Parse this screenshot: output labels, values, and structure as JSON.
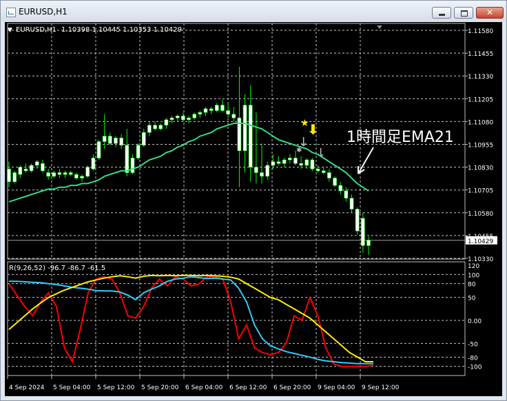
{
  "window": {
    "title": "EURUSD,H1",
    "close_glyph": "✕"
  },
  "chart_data": [
    {
      "type": "candlestick",
      "symbol_label": "EURUSD,H1",
      "ohlc_label": "1.10398 1.10445 1.10353 1.10429",
      "current_price": "1.10429",
      "annotation": "1時間足EMA21",
      "ylim": [
        1.1033,
        1.1158
      ],
      "price_ticks": [
        "1.11580",
        "1.11455",
        "1.11330",
        "1.11205",
        "1.11080",
        "1.10955",
        "1.10830",
        "1.10705",
        "1.10580",
        "1.10455",
        "1.10330"
      ],
      "grid": true,
      "colors": {
        "candle_bull": "#ffffff",
        "candle_bear": "#ffffff",
        "wick": "#00ff00",
        "ema": "#33dd88"
      },
      "candles": [
        [
          1.1082,
          1.1086,
          1.1072,
          1.1075
        ],
        [
          1.1075,
          1.1081,
          1.1074,
          1.108
        ],
        [
          1.1079,
          1.1084,
          1.1077,
          1.1083
        ],
        [
          1.1082,
          1.1085,
          1.108,
          1.1081
        ],
        [
          1.1081,
          1.1085,
          1.108,
          1.1084
        ],
        [
          1.1084,
          1.1087,
          1.1082,
          1.1086
        ],
        [
          1.1085,
          1.1087,
          1.108,
          1.1081
        ],
        [
          1.108,
          1.1082,
          1.1076,
          1.1078
        ],
        [
          1.1078,
          1.1081,
          1.1077,
          1.108
        ],
        [
          1.108,
          1.1082,
          1.1077,
          1.1079
        ],
        [
          1.1079,
          1.1081,
          1.1077,
          1.108
        ],
        [
          1.108,
          1.1081,
          1.1078,
          1.1079
        ],
        [
          1.1079,
          1.108,
          1.1076,
          1.1077
        ],
        [
          1.1077,
          1.1079,
          1.1075,
          1.1078
        ],
        [
          1.1078,
          1.1084,
          1.1077,
          1.1083
        ],
        [
          1.1082,
          1.109,
          1.1081,
          1.1088
        ],
        [
          1.1088,
          1.1098,
          1.1087,
          1.1097
        ],
        [
          1.1097,
          1.1112,
          1.1093,
          1.11
        ],
        [
          1.11,
          1.1102,
          1.1095,
          1.1096
        ],
        [
          1.1096,
          1.11,
          1.1094,
          1.1099
        ],
        [
          1.1099,
          1.1101,
          1.1093,
          1.1095
        ],
        [
          1.1095,
          1.1104,
          1.1078,
          1.108
        ],
        [
          1.108,
          1.109,
          1.1079,
          1.1088
        ],
        [
          1.1088,
          1.1096,
          1.1087,
          1.1095
        ],
        [
          1.1095,
          1.1104,
          1.1094,
          1.1102
        ],
        [
          1.1102,
          1.1108,
          1.11,
          1.1106
        ],
        [
          1.1106,
          1.1108,
          1.1103,
          1.1104
        ],
        [
          1.1104,
          1.1107,
          1.1103,
          1.1106
        ],
        [
          1.1106,
          1.111,
          1.1104,
          1.1109
        ],
        [
          1.1109,
          1.1111,
          1.1107,
          1.111
        ],
        [
          1.111,
          1.1112,
          1.1108,
          1.1111
        ],
        [
          1.1111,
          1.1113,
          1.1108,
          1.1109
        ],
        [
          1.1109,
          1.1111,
          1.1107,
          1.111
        ],
        [
          1.111,
          1.1113,
          1.1109,
          1.1112
        ],
        [
          1.1112,
          1.1114,
          1.111,
          1.1113
        ],
        [
          1.1113,
          1.1116,
          1.1111,
          1.1115
        ],
        [
          1.1115,
          1.1116,
          1.1112,
          1.1114
        ],
        [
          1.1114,
          1.1118,
          1.1113,
          1.1117
        ],
        [
          1.1117,
          1.112,
          1.1113,
          1.1114
        ],
        [
          1.1114,
          1.1118,
          1.111,
          1.1112
        ],
        [
          1.1112,
          1.1116,
          1.1108,
          1.111
        ],
        [
          1.111,
          1.1138,
          1.1072,
          1.1092
        ],
        [
          1.1092,
          1.1123,
          1.108,
          1.1117
        ],
        [
          1.1117,
          1.1128,
          1.1075,
          1.1083
        ],
        [
          1.1083,
          1.1113,
          1.1074,
          1.108
        ],
        [
          1.108,
          1.1096,
          1.1074,
          1.1078
        ],
        [
          1.1078,
          1.1086,
          1.1076,
          1.1084
        ],
        [
          1.1084,
          1.109,
          1.1082,
          1.1086
        ],
        [
          1.1086,
          1.1089,
          1.1084,
          1.1085
        ],
        [
          1.1085,
          1.1088,
          1.1083,
          1.1087
        ],
        [
          1.1087,
          1.109,
          1.1085,
          1.1088
        ],
        [
          1.1088,
          1.1092,
          1.1084,
          1.1085
        ],
        [
          1.1085,
          1.1089,
          1.1082,
          1.1084
        ],
        [
          1.1084,
          1.1088,
          1.1082,
          1.1087
        ],
        [
          1.1087,
          1.1088,
          1.1081,
          1.1082
        ],
        [
          1.1082,
          1.1084,
          1.108,
          1.1081
        ],
        [
          1.1081,
          1.1083,
          1.1079,
          1.108
        ],
        [
          1.108,
          1.1082,
          1.1075,
          1.1077
        ],
        [
          1.1077,
          1.1078,
          1.1072,
          1.1073
        ],
        [
          1.1073,
          1.1075,
          1.1068,
          1.107
        ],
        [
          1.107,
          1.1072,
          1.1064,
          1.1066
        ],
        [
          1.1066,
          1.1068,
          1.1058,
          1.106
        ],
        [
          1.106,
          1.1061,
          1.1046,
          1.1048
        ],
        [
          1.1055,
          1.1058,
          1.1036,
          1.104
        ],
        [
          1.104,
          1.1045,
          1.1035,
          1.1043
        ]
      ],
      "ema21": [
        1.1064,
        1.1065,
        1.1066,
        1.1067,
        1.1068,
        1.1069,
        1.107,
        1.1071,
        1.1071,
        1.1072,
        1.1072,
        1.1073,
        1.1073,
        1.1074,
        1.1074,
        1.1075,
        1.1076,
        1.1078,
        1.1079,
        1.108,
        1.1081,
        1.1081,
        1.1082,
        1.1083,
        1.1085,
        1.1087,
        1.1088,
        1.1089,
        1.1091,
        1.1092,
        1.1094,
        1.1095,
        1.1097,
        1.1098,
        1.11,
        1.1101,
        1.1102,
        1.1104,
        1.1105,
        1.1106,
        1.1107,
        1.1107,
        1.1107,
        1.1106,
        1.1105,
        1.1104,
        1.1102,
        1.11,
        1.1098,
        1.1097,
        1.1096,
        1.1095,
        1.1094,
        1.1093,
        1.1091,
        1.109,
        1.1088,
        1.1086,
        1.1084,
        1.1082,
        1.108,
        1.1077,
        1.1074,
        1.1072,
        1.107
      ]
    },
    {
      "type": "line",
      "label": "R(9,26,52) -96.7 -86.7 -61.5",
      "ylim": [
        -120,
        120
      ],
      "ticks": [
        "120",
        "100",
        "80",
        "50",
        "0.00",
        "-50",
        "-80",
        "-100"
      ],
      "x_tick_labels": [
        "4 Sep 2024",
        "5 Sep 04:00",
        "5 Sep 12:00",
        "5 Sep 20:00",
        "6 Sep 04:00",
        "6 Sep 12:00",
        "6 Sep 20:00",
        "9 Sep 04:00",
        "9 Sep 12:00"
      ],
      "series": [
        {
          "color": "#ff0000",
          "values": [
            80,
            55,
            30,
            10,
            40,
            60,
            30,
            -60,
            -90,
            -20,
            60,
            90,
            95,
            90,
            60,
            10,
            5,
            30,
            70,
            90,
            75,
            95,
            90,
            75,
            80,
            95,
            95,
            90,
            40,
            -40,
            -10,
            -60,
            -70,
            -75,
            -70,
            -50,
            10,
            0,
            50,
            10,
            -60,
            -95,
            -100,
            -100,
            -100,
            -100,
            -98
          ]
        },
        {
          "color": "#33ccff",
          "values": [
            85,
            85,
            84,
            83,
            82,
            80,
            78,
            75,
            72,
            70,
            68,
            65,
            64,
            64,
            62,
            55,
            45,
            60,
            68,
            75,
            85,
            90,
            92,
            95,
            93,
            91,
            92,
            90,
            88,
            70,
            40,
            -10,
            -40,
            -55,
            -62,
            -68,
            -72,
            -76,
            -80,
            -85,
            -88,
            -90,
            -92,
            -93,
            -94,
            -94,
            -94
          ]
        },
        {
          "color": "#ffee00",
          "values": [
            -20,
            -5,
            10,
            25,
            38,
            50,
            58,
            66,
            72,
            78,
            84,
            88,
            92,
            95,
            97,
            95,
            92,
            96,
            98,
            97,
            98,
            97,
            98,
            98,
            97,
            98,
            97,
            96,
            94,
            90,
            80,
            70,
            60,
            50,
            45,
            35,
            25,
            15,
            5,
            -10,
            -25,
            -40,
            -55,
            -70,
            -80,
            -90,
            -90
          ]
        }
      ]
    }
  ]
}
